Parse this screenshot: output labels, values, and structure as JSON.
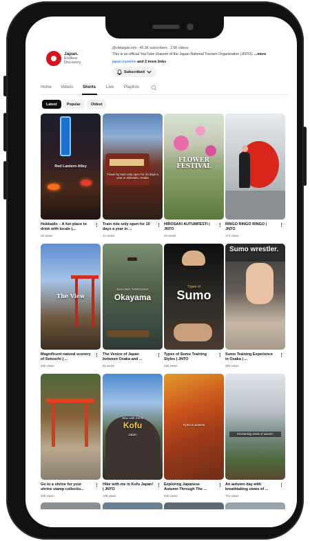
{
  "channel": {
    "logo_text": [
      "Japan.",
      "Endless",
      "Discovery."
    ],
    "handle": "@visitjapan.info · 40.3K subscribers · 3.5K videos",
    "description": "This is an official YouTube channel of the Japan National Tourism Organization (JNTO).",
    "description_more": "...more",
    "link_url": "japan.travel/en",
    "link_more": "and 2 more links",
    "subscribed_label": "Subscribed"
  },
  "tabs": [
    "Home",
    "Videos",
    "Shorts",
    "Live",
    "Playlists"
  ],
  "active_tab": "Shorts",
  "chips": [
    "Latest",
    "Popular",
    "Oldest"
  ],
  "selected_chip": "Latest",
  "shorts": [
    {
      "title": "Hokkaido – A fun place to drink with locals |...",
      "views": "20 views",
      "overlay": "Red Lantern Alley"
    },
    {
      "title": "Train ride only open for 10 days a year in ...",
      "views": "13 views",
      "overlay": "Travel by train only open for 10 days a year in Shiroishi, Osaka"
    },
    {
      "title": "HIROSAKI AUTUMFESTI | JNTO",
      "views": "20 views",
      "overlay": "FLOWER FESTIVAL"
    },
    {
      "title": "RINGO RINGO RINGO | JNTO",
      "views": "171 views",
      "overlay": ""
    },
    {
      "title": "Magnificent natural scenery of Setouchi | ...",
      "views": "325 views",
      "overlay": "The View"
    },
    {
      "title": "The Venice of Japan between Osaka and ...",
      "views": "92 views",
      "overlay": "Okayama",
      "overlay_small": "SAILING THROUGH"
    },
    {
      "title": "Types of Sumo Training Styles | JNTO",
      "views": "225 views",
      "overlay": "Sumo",
      "overlay_small": "Types of"
    },
    {
      "title": "Sumo Training Experience in Osaka | ...",
      "views": "360 views",
      "overlay": "Sumo wrestler."
    },
    {
      "title": "Go to a shrine for your shrine stamp collectio...",
      "views": "325 views",
      "overlay": ""
    },
    {
      "title": "Hike with me in Kofu Japan! | JNTO",
      "views": "109 views",
      "overlay": "Kofu",
      "overlay_small": "Hike with me in",
      "overlay_sub": "Japan"
    },
    {
      "title": "Exploring Japanese Autumn Through The ...",
      "views": "630 views",
      "overlay": "",
      "overlay_small": "Kyoto in autumn"
    },
    {
      "title": "An autumn day with breathtaking views of ...",
      "views": "701 views",
      "overlay": "",
      "overlay_small": "Enchanting views of autumn"
    }
  ],
  "colors": {
    "brand_red": "#d6141e",
    "link_blue": "#065fd4",
    "text_primary": "#0f0f0f",
    "text_secondary": "#606060"
  },
  "icons": [
    "bell-icon",
    "chevron-down-icon",
    "search-icon",
    "more-vert-icon"
  ]
}
